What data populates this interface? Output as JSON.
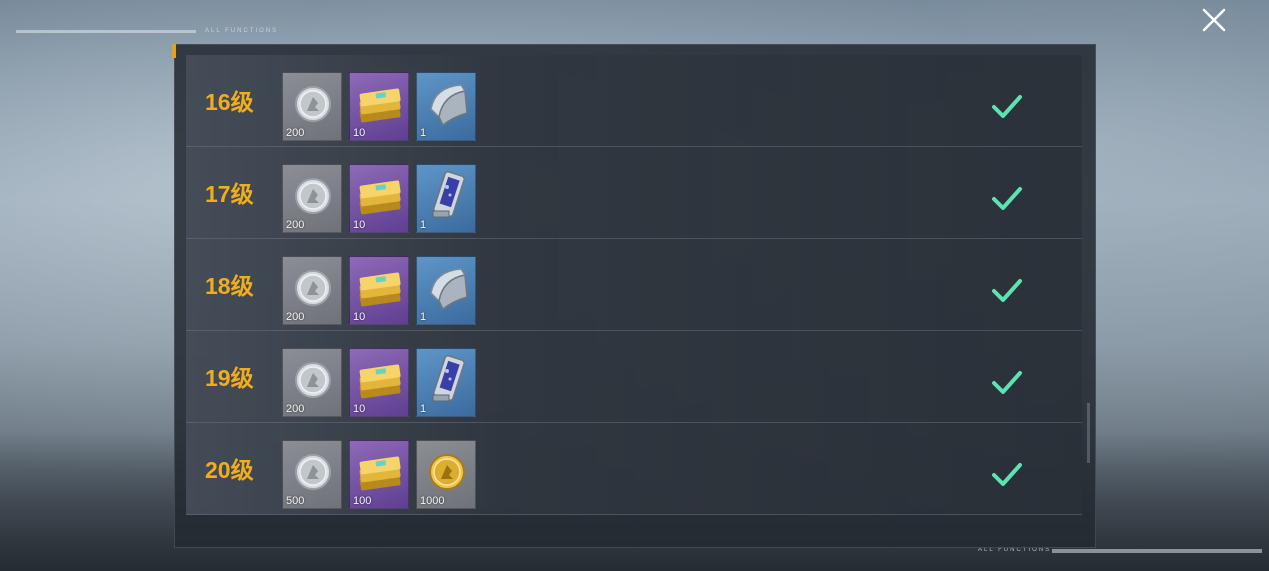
{
  "header": {
    "label": "ALL FUNCTIONS"
  },
  "footer": {
    "label": "ALL FUNCTIONS"
  },
  "colors": {
    "level": "#f2ad1c",
    "check": "#5ee3b0"
  },
  "rows": [
    {
      "level": "16级",
      "items": [
        {
          "icon": "silver-coin-icon",
          "count": "200"
        },
        {
          "icon": "gold-ticket-icon",
          "count": "10"
        },
        {
          "icon": "armor-plate-icon",
          "count": "1"
        }
      ],
      "claimed": true
    },
    {
      "level": "17级",
      "items": [
        {
          "icon": "silver-coin-icon",
          "count": "200"
        },
        {
          "icon": "gold-ticket-icon",
          "count": "10"
        },
        {
          "icon": "card-device-icon",
          "count": "1"
        }
      ],
      "claimed": true
    },
    {
      "level": "18级",
      "items": [
        {
          "icon": "silver-coin-icon",
          "count": "200"
        },
        {
          "icon": "gold-ticket-icon",
          "count": "10"
        },
        {
          "icon": "armor-plate-icon",
          "count": "1"
        }
      ],
      "claimed": true
    },
    {
      "level": "19级",
      "items": [
        {
          "icon": "silver-coin-icon",
          "count": "200"
        },
        {
          "icon": "gold-ticket-icon",
          "count": "10"
        },
        {
          "icon": "card-device-icon",
          "count": "1"
        }
      ],
      "claimed": true
    },
    {
      "level": "20级",
      "items": [
        {
          "icon": "silver-coin-icon",
          "count": "500"
        },
        {
          "icon": "gold-ticket-icon",
          "count": "100"
        },
        {
          "icon": "gold-coin-icon",
          "count": "1000"
        }
      ],
      "claimed": true
    }
  ]
}
